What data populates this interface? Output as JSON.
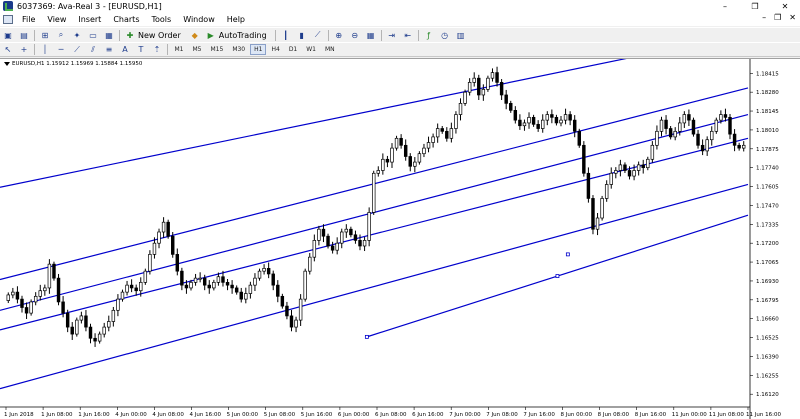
{
  "window": {
    "title": "6037369: Ava-Real 3 - [EURUSD,H1]",
    "controls": [
      "–",
      "❐",
      "✕"
    ],
    "mdi_controls": [
      "–",
      "❐",
      "✕"
    ]
  },
  "menu": [
    "File",
    "View",
    "Insert",
    "Charts",
    "Tools",
    "Window",
    "Help"
  ],
  "toolbar": {
    "new_order_label": "New Order",
    "autotrading_label": "AutoTrading"
  },
  "timeframes": [
    "M1",
    "M5",
    "M15",
    "M30",
    "H1",
    "H4",
    "D1",
    "W1",
    "MN"
  ],
  "active_timeframe": "H1",
  "chart_info": {
    "symbol_line": "EURUSD,H1  1.15912 1.15969 1.15884 1.15950"
  },
  "chart_data": {
    "type": "candlestick",
    "symbol": "EURUSD",
    "timeframe": "H1",
    "y_ticks": [
      "1.18415",
      "1.18280",
      "1.18145",
      "1.18010",
      "1.17875",
      "1.17740",
      "1.17605",
      "1.17470",
      "1.17335",
      "1.17200",
      "1.17065",
      "1.16930",
      "1.16795",
      "1.16660",
      "1.16525",
      "1.16390",
      "1.16255",
      "1.16120"
    ],
    "x_ticks": [
      "1 Jun 2018",
      "1 Jun 08:00",
      "1 Jun 16:00",
      "4 Jun 00:00",
      "4 Jun 08:00",
      "4 Jun 16:00",
      "5 Jun 00:00",
      "5 Jun 08:00",
      "5 Jun 16:00",
      "6 Jun 00:00",
      "6 Jun 08:00",
      "6 Jun 16:00",
      "7 Jun 00:00",
      "7 Jun 08:00",
      "7 Jun 16:00",
      "8 Jun 00:00",
      "8 Jun 08:00",
      "8 Jun 16:00",
      "11 Jun 00:00",
      "11 Jun 08:00",
      "11 Jun 16:00"
    ],
    "ylim": [
      1.1605,
      1.1846
    ],
    "channel_color": "#0000cc",
    "candle_color": "#000000",
    "closes": [
      1.1683,
      1.1685,
      1.168,
      1.1674,
      1.167,
      1.1678,
      1.1682,
      1.1686,
      1.1688,
      1.1705,
      1.1695,
      1.1678,
      1.167,
      1.166,
      1.1655,
      1.1665,
      1.1668,
      1.166,
      1.1652,
      1.165,
      1.1655,
      1.166,
      1.1664,
      1.1672,
      1.168,
      1.1685,
      1.169,
      1.1688,
      1.1686,
      1.1692,
      1.17,
      1.1712,
      1.172,
      1.1728,
      1.1735,
      1.1725,
      1.1712,
      1.17,
      1.169,
      1.1688,
      1.1692,
      1.1695,
      1.1695,
      1.169,
      1.1688,
      1.1692,
      1.1696,
      1.1692,
      1.169,
      1.1688,
      1.1685,
      1.168,
      1.1684,
      1.169,
      1.1695,
      1.17,
      1.1702,
      1.1698,
      1.169,
      1.1682,
      1.1675,
      1.1668,
      1.166,
      1.1665,
      1.168,
      1.17,
      1.171,
      1.1722,
      1.173,
      1.1725,
      1.1718,
      1.1715,
      1.172,
      1.1728,
      1.173,
      1.1726,
      1.1722,
      1.1718,
      1.1722,
      1.1742,
      1.177,
      1.1772,
      1.178,
      1.1778,
      1.1788,
      1.1795,
      1.179,
      1.1782,
      1.1775,
      1.1778,
      1.1784,
      1.1788,
      1.1792,
      1.1796,
      1.1802,
      1.18,
      1.1795,
      1.1802,
      1.1812,
      1.182,
      1.1828,
      1.1835,
      1.1838,
      1.1826,
      1.183,
      1.1838,
      1.1842,
      1.1835,
      1.1826,
      1.182,
      1.1815,
      1.1808,
      1.1804,
      1.1806,
      1.181,
      1.1805,
      1.1802,
      1.1808,
      1.1812,
      1.181,
      1.1806,
      1.1808,
      1.1812,
      1.1808,
      1.18,
      1.179,
      1.177,
      1.1752,
      1.173,
      1.1738,
      1.1752,
      1.1762,
      1.177,
      1.1772,
      1.1776,
      1.1772,
      1.1768,
      1.1772,
      1.1776,
      1.1774,
      1.178,
      1.179,
      1.18,
      1.1808,
      1.1802,
      1.1796,
      1.18,
      1.1806,
      1.1812,
      1.1808,
      1.1798,
      1.179,
      1.1786,
      1.1794,
      1.18,
      1.1808,
      1.1812,
      1.181,
      1.1798,
      1.179,
      1.1788,
      1.179
    ]
  }
}
